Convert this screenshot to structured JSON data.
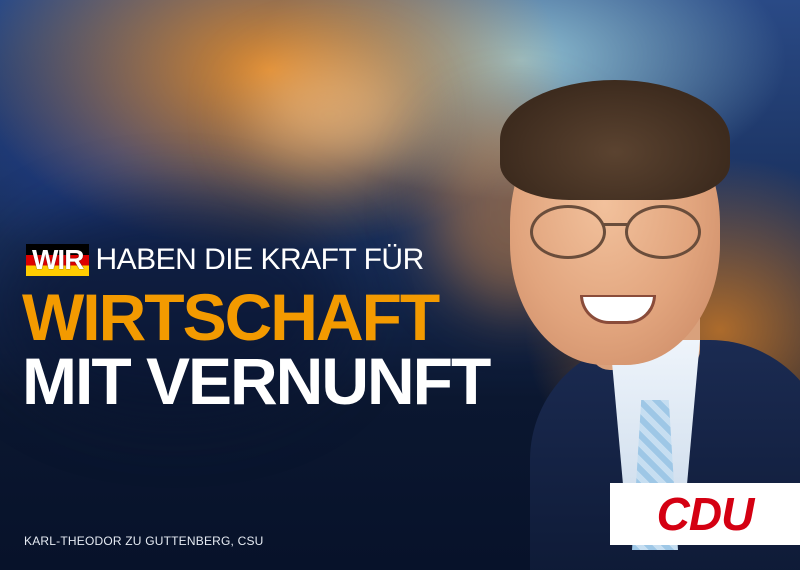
{
  "headline": {
    "badge": "WIR",
    "line1": "HABEN DIE KRAFT FÜR",
    "line2": "WIRTSCHAFT",
    "line3": "MIT VERNUNFT"
  },
  "caption": "KARL-THEODOR ZU GUTTENBERG, CSU",
  "logo": {
    "text": "CDU"
  },
  "colors": {
    "accent_orange": "#f39a00",
    "cdu_red": "#d40012",
    "flag": [
      "#000000",
      "#dd0000",
      "#ffcc00"
    ]
  }
}
